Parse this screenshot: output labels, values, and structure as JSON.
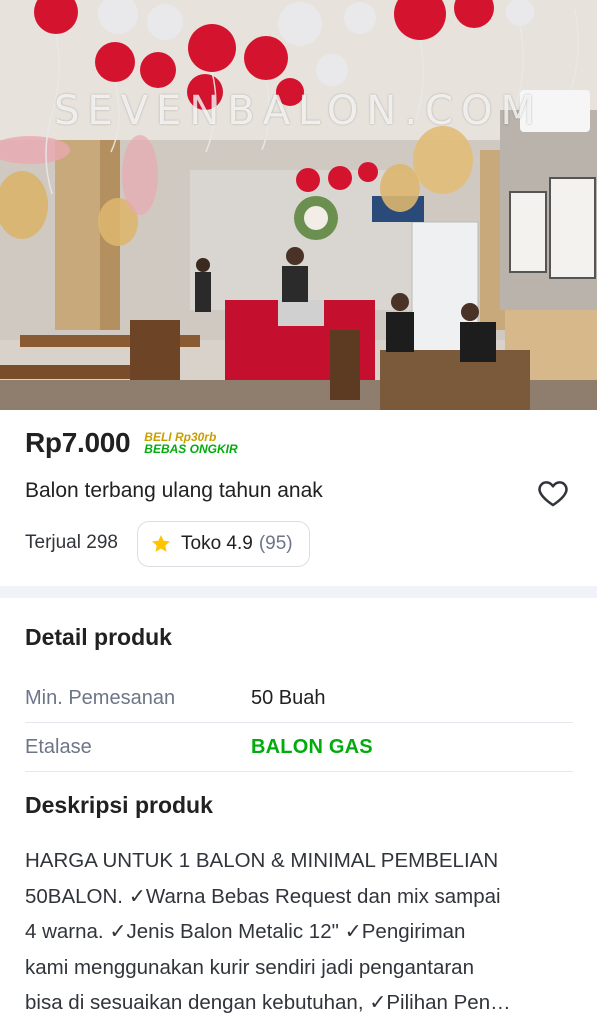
{
  "product": {
    "image_watermark": "SEVENBALON.COM",
    "price": "Rp7.000",
    "promo_line1": "BELI Rp30rb",
    "promo_line2": "BEBAS ONGKIR",
    "title": "Balon terbang ulang tahun anak",
    "sold": "Terjual 298",
    "shop_rating_label": "Toko 4.9",
    "shop_rating_count": "(95)",
    "wishlist_icon": "heart-outline-icon",
    "rating_icon": "star-icon",
    "rating_star_color": "#ffc400"
  },
  "detail": {
    "title": "Detail produk",
    "rows": [
      {
        "label": "Min. Pemesanan",
        "value": "50 Buah"
      },
      {
        "label": "Etalase",
        "value": "BALON GAS"
      }
    ],
    "link_color": "#03ac0e"
  },
  "description": {
    "title": "Deskripsi produk",
    "lines": [
      "HARGA UNTUK 1 BALON & MINIMAL PEMBELIAN",
      "50BALON. ✓Warna Bebas Request dan mix sampai",
      "4 warna. ✓Jenis Balon Metalic 12\" ✓Pengiriman",
      "kami menggunakan kurir sendiri jadi pengantaran",
      "bisa di sesuaikan dengan kebutuhan, ✓Pilihan Pen…"
    ]
  }
}
